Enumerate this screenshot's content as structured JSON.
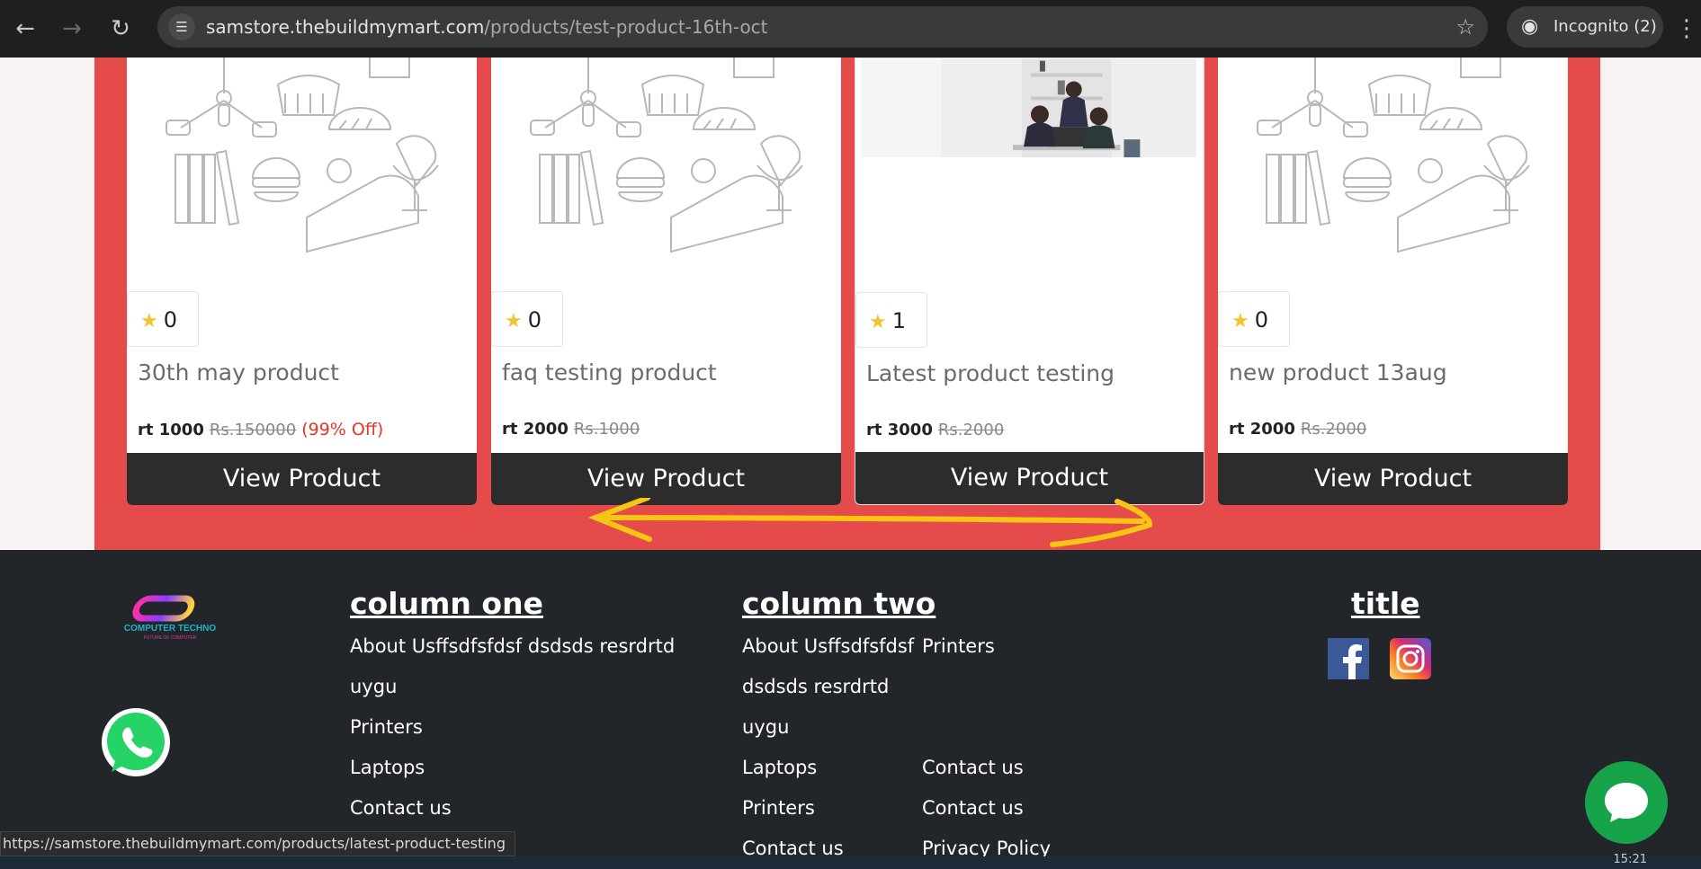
{
  "browser": {
    "url_domain": "samstore.thebuildmymart.com",
    "url_path": "/products/test-product-16th-oct",
    "incognito_label": "Incognito (2)",
    "status_url": "https://samstore.thebuildmymart.com/products/latest-product-testing",
    "clock": "15:21"
  },
  "products": [
    {
      "rating": "0",
      "title": "30th may product",
      "price": "rt 1000",
      "old_price": "Rs.150000",
      "discount": "(99% Off)",
      "button": "View Product",
      "image": "doodle"
    },
    {
      "rating": "0",
      "title": "faq testing product",
      "price": "rt 2000",
      "old_price": "Rs.1000",
      "discount": "",
      "button": "View Product",
      "image": "doodle"
    },
    {
      "rating": "1",
      "title": "Latest product testing",
      "price": "rt 3000",
      "old_price": "Rs.2000",
      "discount": "",
      "button": "View Product",
      "image": "photo"
    },
    {
      "rating": "0",
      "title": "new product 13aug",
      "price": "rt 2000",
      "old_price": "Rs.2000",
      "discount": "",
      "button": "View Product",
      "image": "doodle"
    }
  ],
  "footer": {
    "logo_text": "COMPUTER TECHNO",
    "logo_tagline": "FUTURE OF COMPUTER",
    "column_one": {
      "title": "column one",
      "links": [
        "About Usffsdfsfdsf dsdsds resrdrtd",
        "uygu",
        "Printers",
        "Laptops",
        "Contact us"
      ]
    },
    "column_two": {
      "title": "column two",
      "links_left": [
        "About Usffsdfsfdsf",
        "dsdsds resrdrtd",
        "uygu",
        "Laptops",
        "Printers",
        "Contact us"
      ],
      "links_right": [
        "Printers",
        "Contact us",
        "Contact us",
        "Privacy Policy"
      ]
    },
    "social": {
      "title": "title",
      "icons": [
        "facebook-icon",
        "instagram-icon"
      ]
    }
  },
  "colors": {
    "section_red": "#e54b4b",
    "footer_bg": "#22252a",
    "button_dark": "#2c2c2c",
    "annotation_yellow": "#f7c613",
    "whatsapp_green": "#25d366",
    "chat_green": "#17a34a"
  }
}
